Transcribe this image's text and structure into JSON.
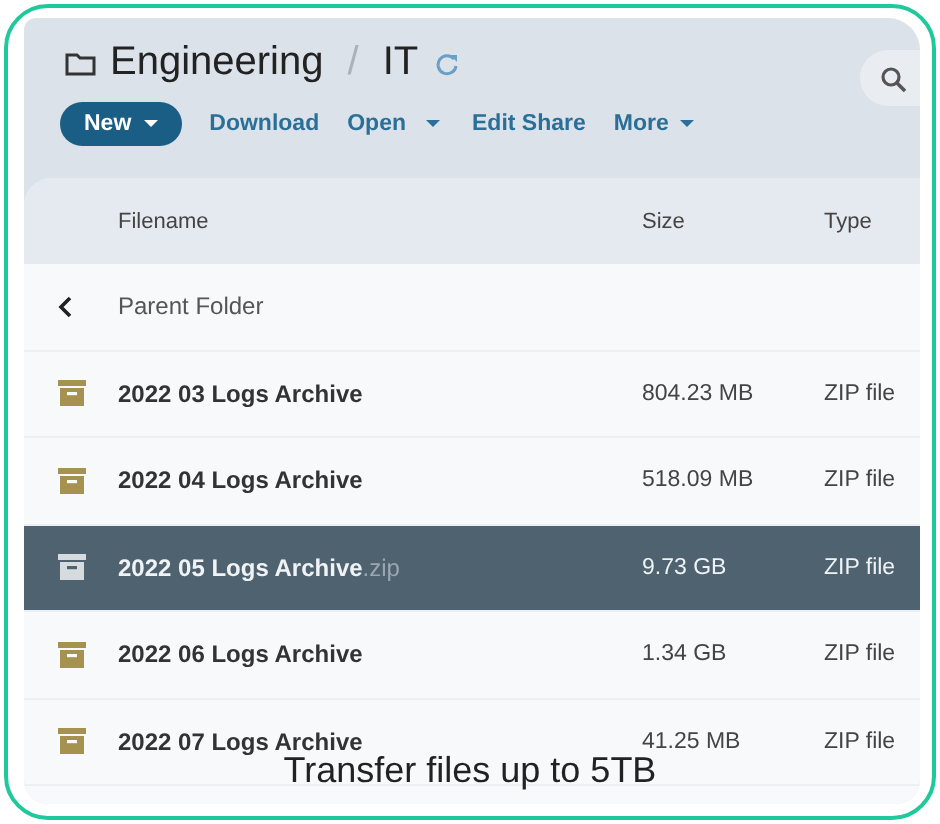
{
  "breadcrumb": {
    "folder": "Engineering",
    "separator": "/",
    "current": "IT"
  },
  "toolbar": [
    {
      "label": "New",
      "kind": "primary",
      "dropdown": true
    },
    {
      "label": "Download",
      "kind": "link",
      "dropdown": false
    },
    {
      "label": "Open",
      "kind": "split",
      "dropdown": true
    },
    {
      "label": "Edit Share",
      "kind": "link",
      "dropdown": false
    },
    {
      "label": "More",
      "kind": "link",
      "dropdown": true
    }
  ],
  "table": {
    "columns": [
      "Filename",
      "Size",
      "Type"
    ],
    "parent": {
      "label": "Parent Folder"
    },
    "rows": [
      {
        "name": "2022 03 Logs Archive",
        "size": "804.23 MB",
        "type": "ZIP file",
        "selected": false
      },
      {
        "name": "2022 04 Logs Archive",
        "size": "518.09 MB",
        "type": "ZIP file",
        "selected": false
      },
      {
        "name": "2022 05 Logs Archive",
        "extension": ".zip",
        "size": "9.73 GB",
        "type": "ZIP file",
        "selected": true
      },
      {
        "name": "2022 06 Logs Archive",
        "size": "1.34 GB",
        "type": "ZIP file",
        "selected": false
      },
      {
        "name": "2022 07 Logs Archive",
        "size": "41.25 MB",
        "type": "ZIP file",
        "selected": false
      }
    ]
  },
  "caption": "Transfer files up to 5TB"
}
